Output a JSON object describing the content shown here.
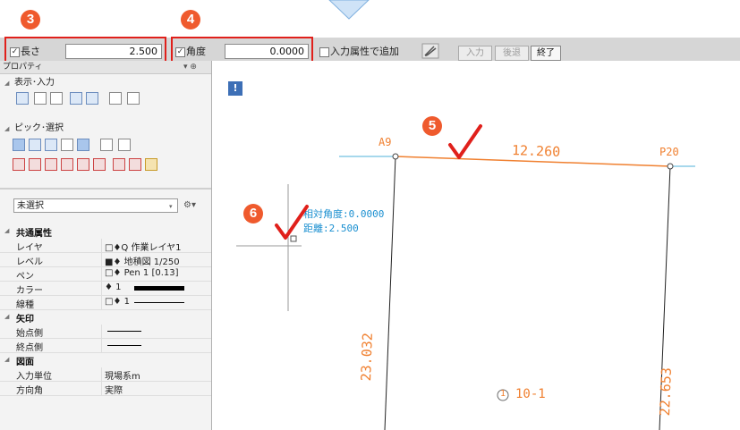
{
  "badges": {
    "b3": "3",
    "b4": "4",
    "b5": "5",
    "b6": "6"
  },
  "toolbar": {
    "length_check": "✓",
    "length_label": "長さ",
    "length_value": "2.500",
    "angle_check": "✓",
    "angle_label": "角度",
    "angle_value": "0.0000",
    "attr_label": "入力属性で追加",
    "btn_input": "入力",
    "btn_back": "後退",
    "btn_end": "終了"
  },
  "panel": {
    "title": "プロパティ",
    "pin": "▾ ⊕",
    "section_view": "表示･入力",
    "section_pick": "ピック･選択",
    "select_value": "未選択",
    "categories": {
      "common": "共通属性",
      "arrow": "矢印",
      "drawing": "図面"
    },
    "rows": [
      {
        "key": "レイヤ",
        "val": "□♦Q 作業レイヤ1"
      },
      {
        "key": "レベル",
        "val": "■♦ 地積図 1/250"
      },
      {
        "key": "ペン",
        "val": "□♦ Pen 1 [0.13]"
      },
      {
        "key": "カラー",
        "val": "♦ 1"
      },
      {
        "key": "線種",
        "val": "□♦ 1"
      }
    ],
    "arrow_rows": [
      {
        "key": "始点側"
      },
      {
        "key": "終点側"
      }
    ],
    "drawing_rows": [
      {
        "key": "入力単位",
        "val": "現場系m"
      },
      {
        "key": "方向角",
        "val": "実際"
      }
    ]
  },
  "canvas": {
    "info_icon": "!",
    "pt_a9": "A9",
    "pt_p20": "P20",
    "dist_top": "12.260",
    "dist_left": "23.032",
    "dist_right": "22.653",
    "parcel": "10-1",
    "parcel_no": "1",
    "readout_angle": "相対角度:0.0000",
    "readout_dist": "距離:2.500"
  },
  "colors": {
    "accent_red": "#e0201b",
    "badge": "#ef5a2d",
    "line_orange": "#f08030",
    "line_cyan": "#4fb0d8",
    "readout_blue": "#1a8fd0"
  }
}
